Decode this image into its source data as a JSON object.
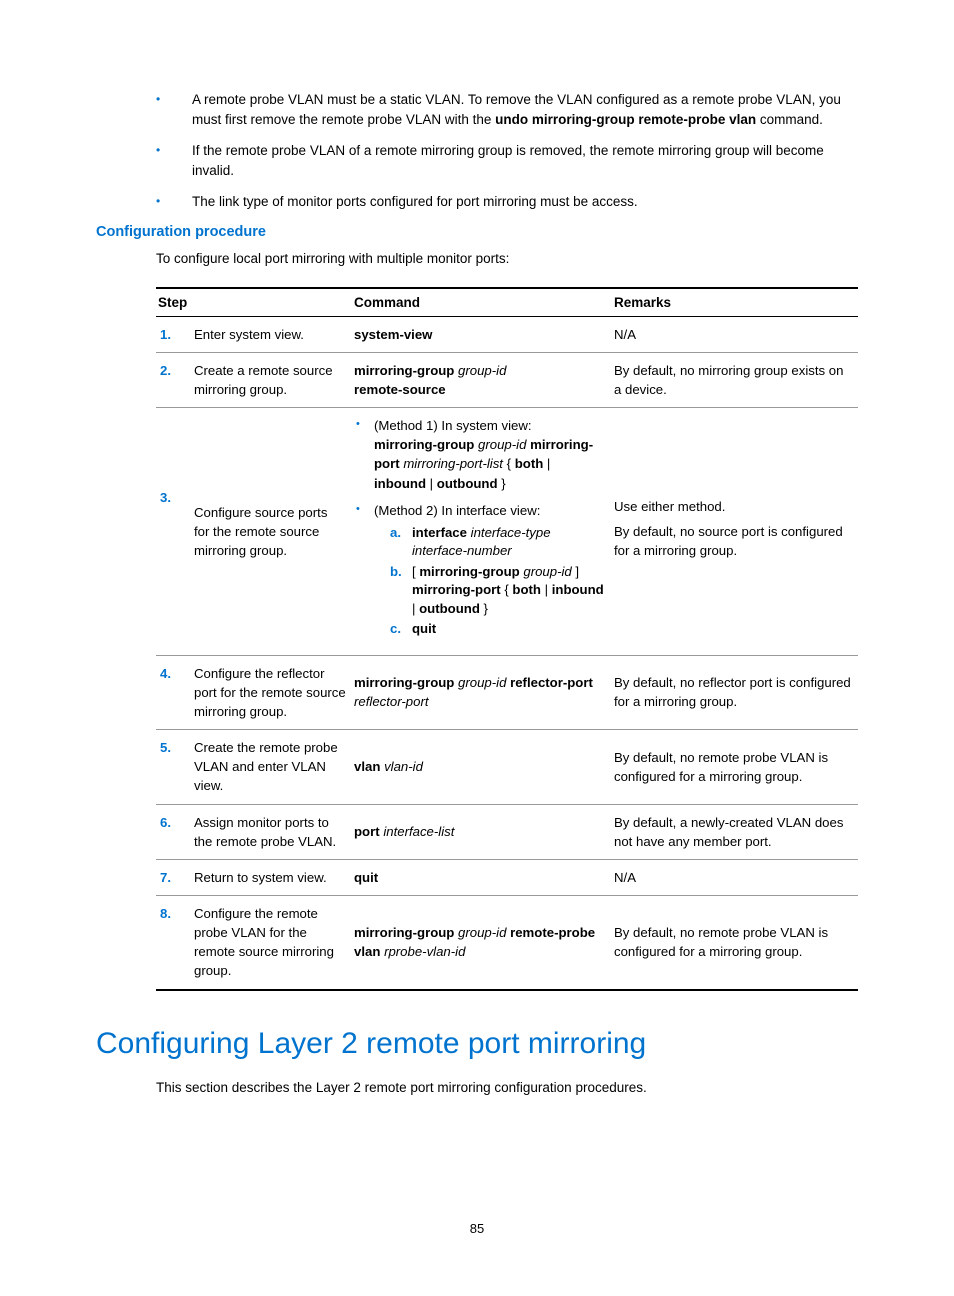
{
  "bullets": [
    {
      "pre": "A remote probe VLAN must be a static VLAN. To remove the VLAN configured as a remote probe VLAN, you must first remove the remote probe VLAN with the ",
      "bold": "undo mirroring-group remote-probe vlan",
      "post": " command."
    },
    {
      "text": "If the remote probe VLAN of a remote mirroring group is removed, the remote mirroring group will become invalid."
    },
    {
      "text": "The link type of monitor ports configured for port mirroring must be access."
    }
  ],
  "section_heading": "Configuration procedure",
  "intro": "To configure local port mirroring with multiple monitor ports:",
  "table": {
    "headers": {
      "step": "Step",
      "command": "Command",
      "remarks": "Remarks"
    },
    "rows": [
      {
        "n": "1.",
        "desc": "Enter system view.",
        "cmd_bold": "system-view",
        "remarks": "N/A"
      },
      {
        "n": "2.",
        "desc": "Create a remote source mirroring group.",
        "cmd_seg": [
          {
            "b": "mirroring-group "
          },
          {
            "i": "group-id "
          },
          {
            "br": true
          },
          {
            "b": "remote-source"
          }
        ],
        "remarks": "By default, no mirroring group exists on a device."
      },
      {
        "n": "3.",
        "desc": "Configure source ports for the remote source mirroring group.",
        "methods": {
          "m1_label": "(Method 1) In system view:",
          "m1_seg": [
            {
              "b": "mirroring-group "
            },
            {
              "i": "group-id "
            },
            {
              "b": "mirroring-port "
            },
            {
              "i": "mirroring-port-list "
            },
            {
              "t": "{ "
            },
            {
              "b": "both"
            },
            {
              "t": " | "
            },
            {
              "b": "inbound"
            },
            {
              "t": " | "
            },
            {
              "b": "outbound"
            },
            {
              "t": " }"
            }
          ],
          "m2_label": "(Method 2) In interface view:",
          "m2a_seg": [
            {
              "b": "interface "
            },
            {
              "i": "interface-type interface-number"
            }
          ],
          "m2b_seg": [
            {
              "t": "[ "
            },
            {
              "b": "mirroring-group "
            },
            {
              "i": "group-id"
            },
            {
              "t": " ] "
            },
            {
              "b": "mirroring-port"
            },
            {
              "t": " { "
            },
            {
              "b": "both"
            },
            {
              "t": " | "
            },
            {
              "b": "inbound"
            },
            {
              "t": " | "
            },
            {
              "b": "outbound"
            },
            {
              "t": " }"
            }
          ],
          "m2c_seg": [
            {
              "b": "quit"
            }
          ],
          "labels": {
            "a": "a.",
            "b": "b.",
            "c": "c."
          }
        },
        "remarks_multi": [
          "Use either method.",
          "By default, no source port is configured for a mirroring group."
        ]
      },
      {
        "n": "4.",
        "desc": "Configure the reflector port for the remote source mirroring group.",
        "cmd_seg": [
          {
            "b": "mirroring-group "
          },
          {
            "i": "group-id "
          },
          {
            "b": "reflector-port "
          },
          {
            "i": "reflector-port"
          }
        ],
        "remarks": "By default, no reflector port is configured for a mirroring group."
      },
      {
        "n": "5.",
        "desc": "Create the remote probe VLAN and enter VLAN view.",
        "cmd_seg": [
          {
            "b": "vlan "
          },
          {
            "i": "vlan-id"
          }
        ],
        "remarks": "By default, no remote probe VLAN is configured for a mirroring group."
      },
      {
        "n": "6.",
        "desc": "Assign monitor ports to the remote probe VLAN.",
        "cmd_seg": [
          {
            "b": "port "
          },
          {
            "i": "interface-list"
          }
        ],
        "remarks": "By default, a newly-created VLAN does not have any member port."
      },
      {
        "n": "7.",
        "desc": "Return to system view.",
        "cmd_bold": "quit",
        "remarks": "N/A"
      },
      {
        "n": "8.",
        "desc": "Configure the remote probe VLAN for the remote source mirroring group.",
        "cmd_seg": [
          {
            "b": "mirroring-group "
          },
          {
            "i": "group-id "
          },
          {
            "b": "remote-probe vlan "
          },
          {
            "i": "rprobe-vlan-id"
          }
        ],
        "remarks": "By default, no remote probe VLAN is configured for a mirroring group."
      }
    ]
  },
  "main_title": "Configuring Layer 2 remote port mirroring",
  "main_intro": "This section describes the Layer 2 remote port mirroring configuration procedures.",
  "page_number": "85"
}
